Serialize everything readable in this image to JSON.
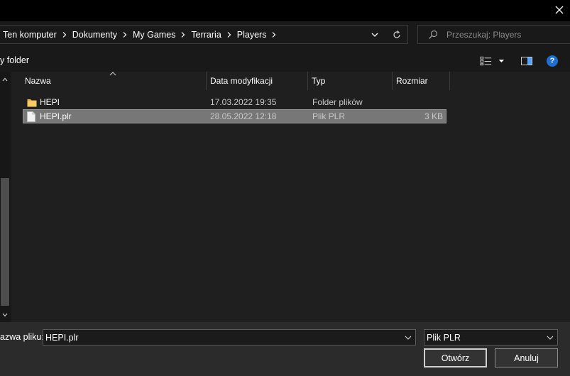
{
  "address": {
    "crumbs": [
      "Ten komputer",
      "Dokumenty",
      "My Games",
      "Terraria",
      "Players"
    ]
  },
  "search": {
    "placeholder": "Przeszukaj: Players"
  },
  "toolbar": {
    "new_folder_label": "y folder"
  },
  "columns": [
    "Nazwa",
    "Data modyfikacji",
    "Typ",
    "Rozmiar"
  ],
  "files": [
    {
      "name": "HEPI",
      "date": "17.03.2022 19:35",
      "type": "Folder plików",
      "size": "",
      "icon": "folder-icon",
      "selected": false
    },
    {
      "name": "HEPI.plr",
      "date": "28.05.2022 12:18",
      "type": "Plik PLR",
      "size": "3 KB",
      "icon": "file-icon",
      "selected": true
    }
  ],
  "bottom": {
    "filename_label": "azwa pliku:",
    "filename_value": "HEPI.plr",
    "filetype_value": "Plik PLR",
    "open_label": "Otwórz",
    "cancel_label": "Anuluj"
  },
  "colors": {
    "background": "#191919",
    "pane": "#1f1f1f",
    "selected_row": "#777777",
    "help_blue": "#1f6fd1"
  }
}
